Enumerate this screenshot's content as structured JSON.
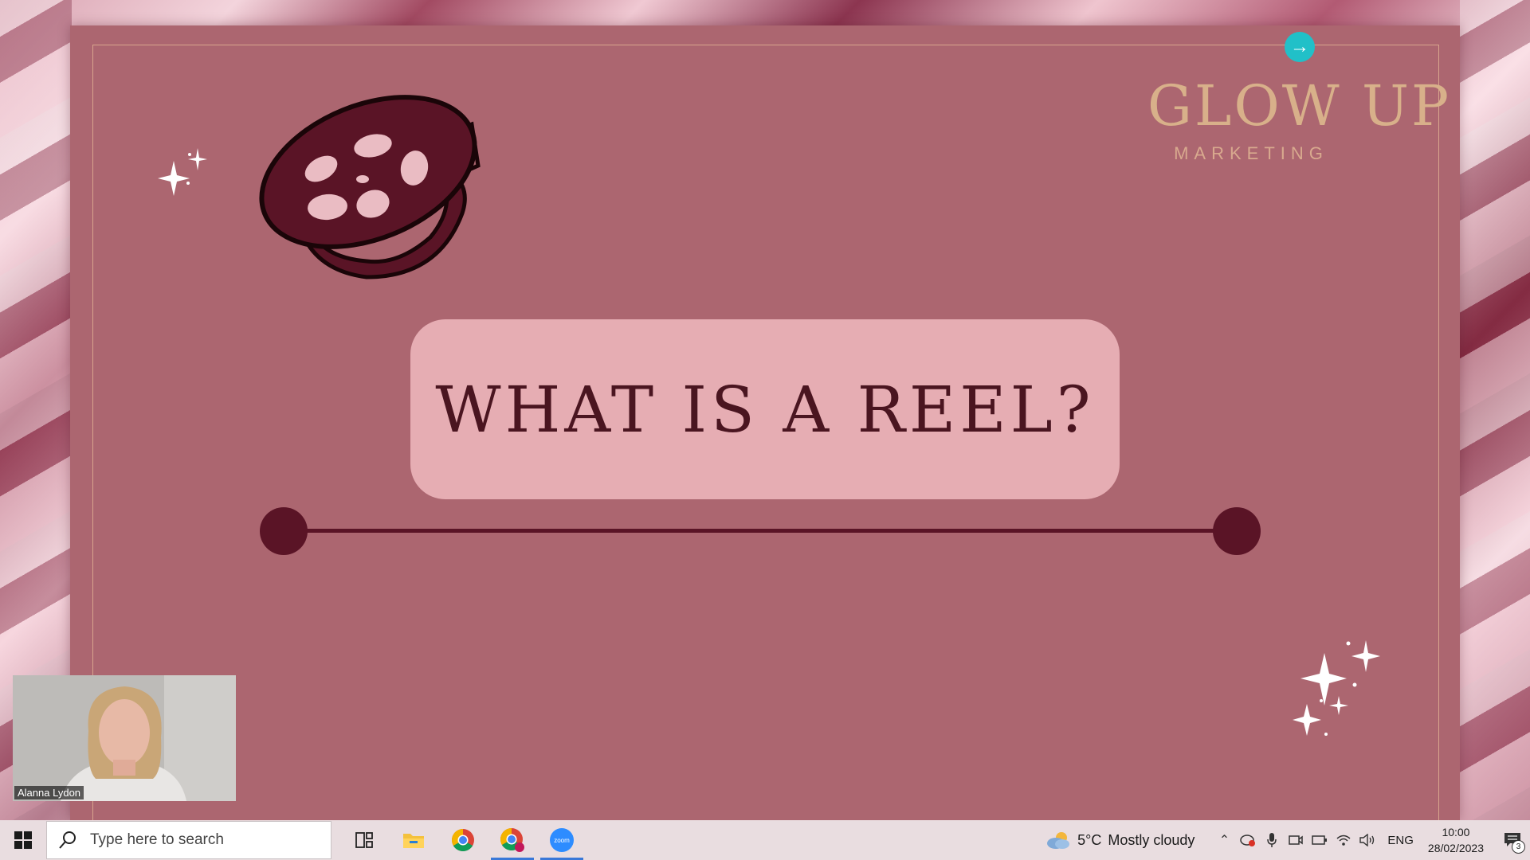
{
  "slide": {
    "title": "WHAT IS A REEL?",
    "logo_title": "GLOW UP",
    "logo_subtitle": "MARKETING",
    "next_icon": "arrow-right-icon",
    "colors": {
      "slide_bg": "#ac6670",
      "title_box": "#e6adb3",
      "title_text": "#4a1520",
      "accent_dark": "#5a1426",
      "logo_gold": "#d8b08a",
      "frame": "#d9a58d",
      "next_button": "#21c0c8"
    }
  },
  "webcam": {
    "name": "Alanna Lydon"
  },
  "taskbar": {
    "search_placeholder": "Type here to search",
    "apps": [
      {
        "name": "task-view-icon",
        "active": false
      },
      {
        "name": "file-explorer-icon",
        "active": false
      },
      {
        "name": "chrome-icon",
        "active": false
      },
      {
        "name": "chrome-profile-icon",
        "active": true
      },
      {
        "name": "zoom-icon",
        "active": true
      }
    ],
    "zoom_label": "zoom",
    "weather": {
      "temp": "5°C",
      "desc": "Mostly cloudy"
    },
    "language": "ENG",
    "time": "10:00",
    "date": "28/02/2023",
    "notifications": "3"
  }
}
